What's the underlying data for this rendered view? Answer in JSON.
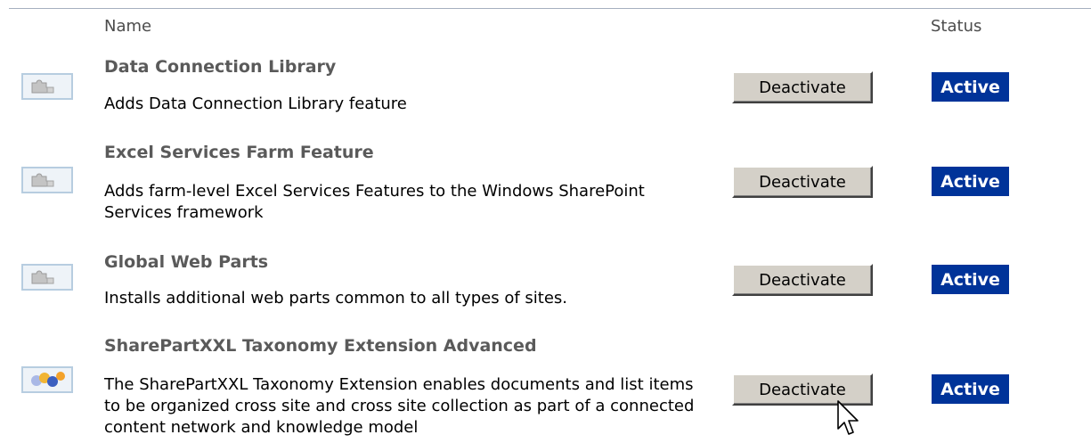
{
  "header": {
    "name_label": "Name",
    "status_label": "Status"
  },
  "features": [
    {
      "icon": "feature-puzzle-icon",
      "title": "Data Connection Library",
      "description": "Adds Data Connection Library feature",
      "button_label": "Deactivate",
      "status": "Active"
    },
    {
      "icon": "feature-puzzle-icon",
      "title": "Excel Services Farm Feature",
      "description": "Adds farm-level Excel Services Features to the Windows SharePoint Services framework",
      "button_label": "Deactivate",
      "status": "Active"
    },
    {
      "icon": "feature-puzzle-icon",
      "title": "Global Web Parts",
      "description": "Installs additional web parts common to all types of sites.",
      "button_label": "Deactivate",
      "status": "Active"
    },
    {
      "icon": "sharepartxxl-logo-icon",
      "title": "SharePartXXL Taxonomy Extension Advanced",
      "description": "The SharePartXXL Taxonomy Extension enables documents and list items to be organized cross site and cross site collection as part of a connected content network and knowledge model",
      "button_label": "Deactivate",
      "status": "Active"
    }
  ],
  "colors": {
    "status_badge_bg": "#003399",
    "button_face": "#d4d0c8",
    "title_text": "#5a5a5a"
  }
}
